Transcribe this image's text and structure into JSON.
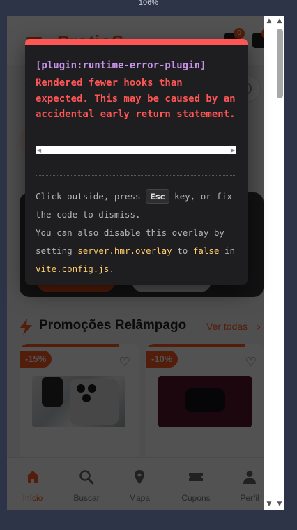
{
  "browser": {
    "zoom": "106%"
  },
  "app": {
    "brand": "ProtioS",
    "cart_badge": "0",
    "notifications_badge": "0",
    "promo_section": {
      "title": "Promoções Relâmpago",
      "see_all": "Ver todas"
    },
    "products": [
      {
        "discount": "-15%",
        "image": "smartphone-photo"
      },
      {
        "discount": "-10%",
        "image": "earbuds-photo"
      }
    ],
    "nav": [
      {
        "label": "Início",
        "icon": "home-icon",
        "active": true
      },
      {
        "label": "Buscar",
        "icon": "search-icon",
        "active": false
      },
      {
        "label": "Mapa",
        "icon": "map-pin-icon",
        "active": false
      },
      {
        "label": "Cupons",
        "icon": "ticket-icon",
        "active": false
      },
      {
        "label": "Perfil",
        "icon": "user-icon",
        "active": false
      }
    ],
    "accent_color": "#ff5a1f"
  },
  "error_overlay": {
    "plugin": "[plugin:runtime-error-plugin]",
    "message": "Rendered fewer hooks than expected. This may be caused by an accidental early return statement.",
    "tip_line1_a": "Click outside, press",
    "tip_key": "Esc",
    "tip_line1_b": "key, or fix the code to dismiss.",
    "tip_line2_a": "You can also disable this overlay by setting",
    "tip_setting": "server.hmr.overlay",
    "tip_line2_b": "to",
    "tip_value": "false",
    "tip_line2_c": "in",
    "tip_file": "vite.config.js",
    "tip_end": ".",
    "colors": {
      "border": "#ff5555",
      "plugin": "#c792ea",
      "highlight": "#ffcb6b"
    }
  }
}
